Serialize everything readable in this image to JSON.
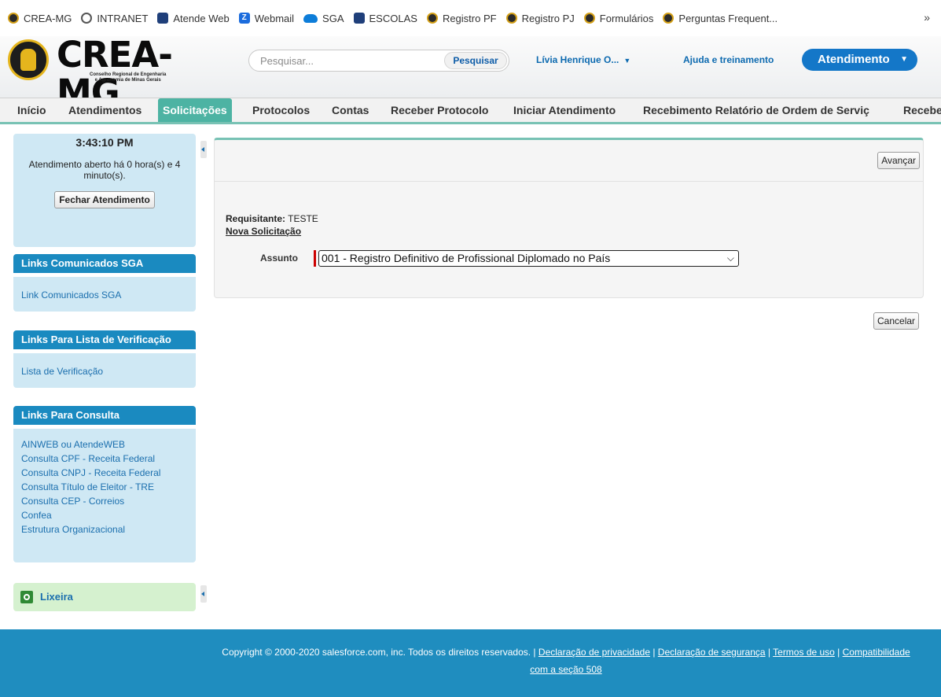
{
  "bookmarks": {
    "items": [
      {
        "label": "CREA-MG",
        "icon": "crea-icon"
      },
      {
        "label": "INTRANET",
        "icon": "globe-icon"
      },
      {
        "label": "Atende Web",
        "icon": "app-icon"
      },
      {
        "label": "Webmail",
        "icon": "z-icon"
      },
      {
        "label": "SGA",
        "icon": "cloud-icon"
      },
      {
        "label": "ESCOLAS",
        "icon": "app-icon"
      },
      {
        "label": "Registro PF",
        "icon": "crea-icon"
      },
      {
        "label": "Registro PJ",
        "icon": "crea-icon"
      },
      {
        "label": "Formulários",
        "icon": "crea-icon"
      },
      {
        "label": "Perguntas Frequent...",
        "icon": "crea-icon"
      }
    ],
    "more": "»"
  },
  "header": {
    "logo_text": "CREA-MG",
    "logo_sub_1": "Conselho Regional de Engenharia",
    "logo_sub_2": "e Agronomia de Minas Gerais",
    "search_placeholder": "Pesquisar...",
    "search_button": "Pesquisar",
    "user_name": "Lívia Henrique O...",
    "help_link": "Ajuda e treinamento",
    "app_name": "Atendimento"
  },
  "tabs": [
    {
      "label": "Início"
    },
    {
      "label": "Atendimentos"
    },
    {
      "label": "Solicitações",
      "active": true
    },
    {
      "label": "Protocolos"
    },
    {
      "label": "Contas"
    },
    {
      "label": "Receber Protocolo"
    },
    {
      "label": "Iniciar Atendimento"
    },
    {
      "label": "Recebimento Relatório de Ordem de Serviç"
    },
    {
      "label": "Recebe"
    }
  ],
  "sidebar": {
    "clock": "3:43:10 PM",
    "open_text": "Atendimento aberto há 0 hora(s) e 4 minuto(s).",
    "close_button": "Fechar Atendimento",
    "sections": [
      {
        "title": "Links Comunicados SGA",
        "links": [
          "Link Comunicados SGA"
        ]
      },
      {
        "title": "Links Para Lista de Verificação",
        "links": [
          "Lista de Verificação"
        ]
      },
      {
        "title": "Links Para Consulta",
        "links": [
          "AINWEB ou AtendeWEB",
          "Consulta CPF - Receita Federal",
          "Consulta CNPJ - Receita Federal",
          "Consulta Título de Eleitor - TRE",
          "Consulta CEP - Correios",
          "Confea",
          "Estrutura Organizacional"
        ]
      }
    ],
    "trash_label": "Lixeira"
  },
  "main": {
    "advance_button": "Avançar",
    "requester_label": "Requisitante:",
    "requester_value": "TESTE",
    "new_request": "Nova Solicitação",
    "subject_label": "Assunto",
    "subject_value": "001 - Registro Definitivo de Profissional Diplomado no País",
    "cancel_button": "Cancelar"
  },
  "footer": {
    "copyright": "Copyright © 2000-2020 salesforce.com, inc. Todos os direitos reservados. |",
    "privacy": "Declaração de privacidade",
    "security": "Declaração de segurança",
    "terms": "Termos de uso",
    "compat": "Compatibilidade com a seção 508"
  },
  "colors": {
    "tab_active": "#4db3a3",
    "sidebar_header": "#1a8ac0",
    "sidebar_body": "#cfe8f4",
    "footer": "#1f8dbf",
    "app_button": "#1477c8"
  }
}
